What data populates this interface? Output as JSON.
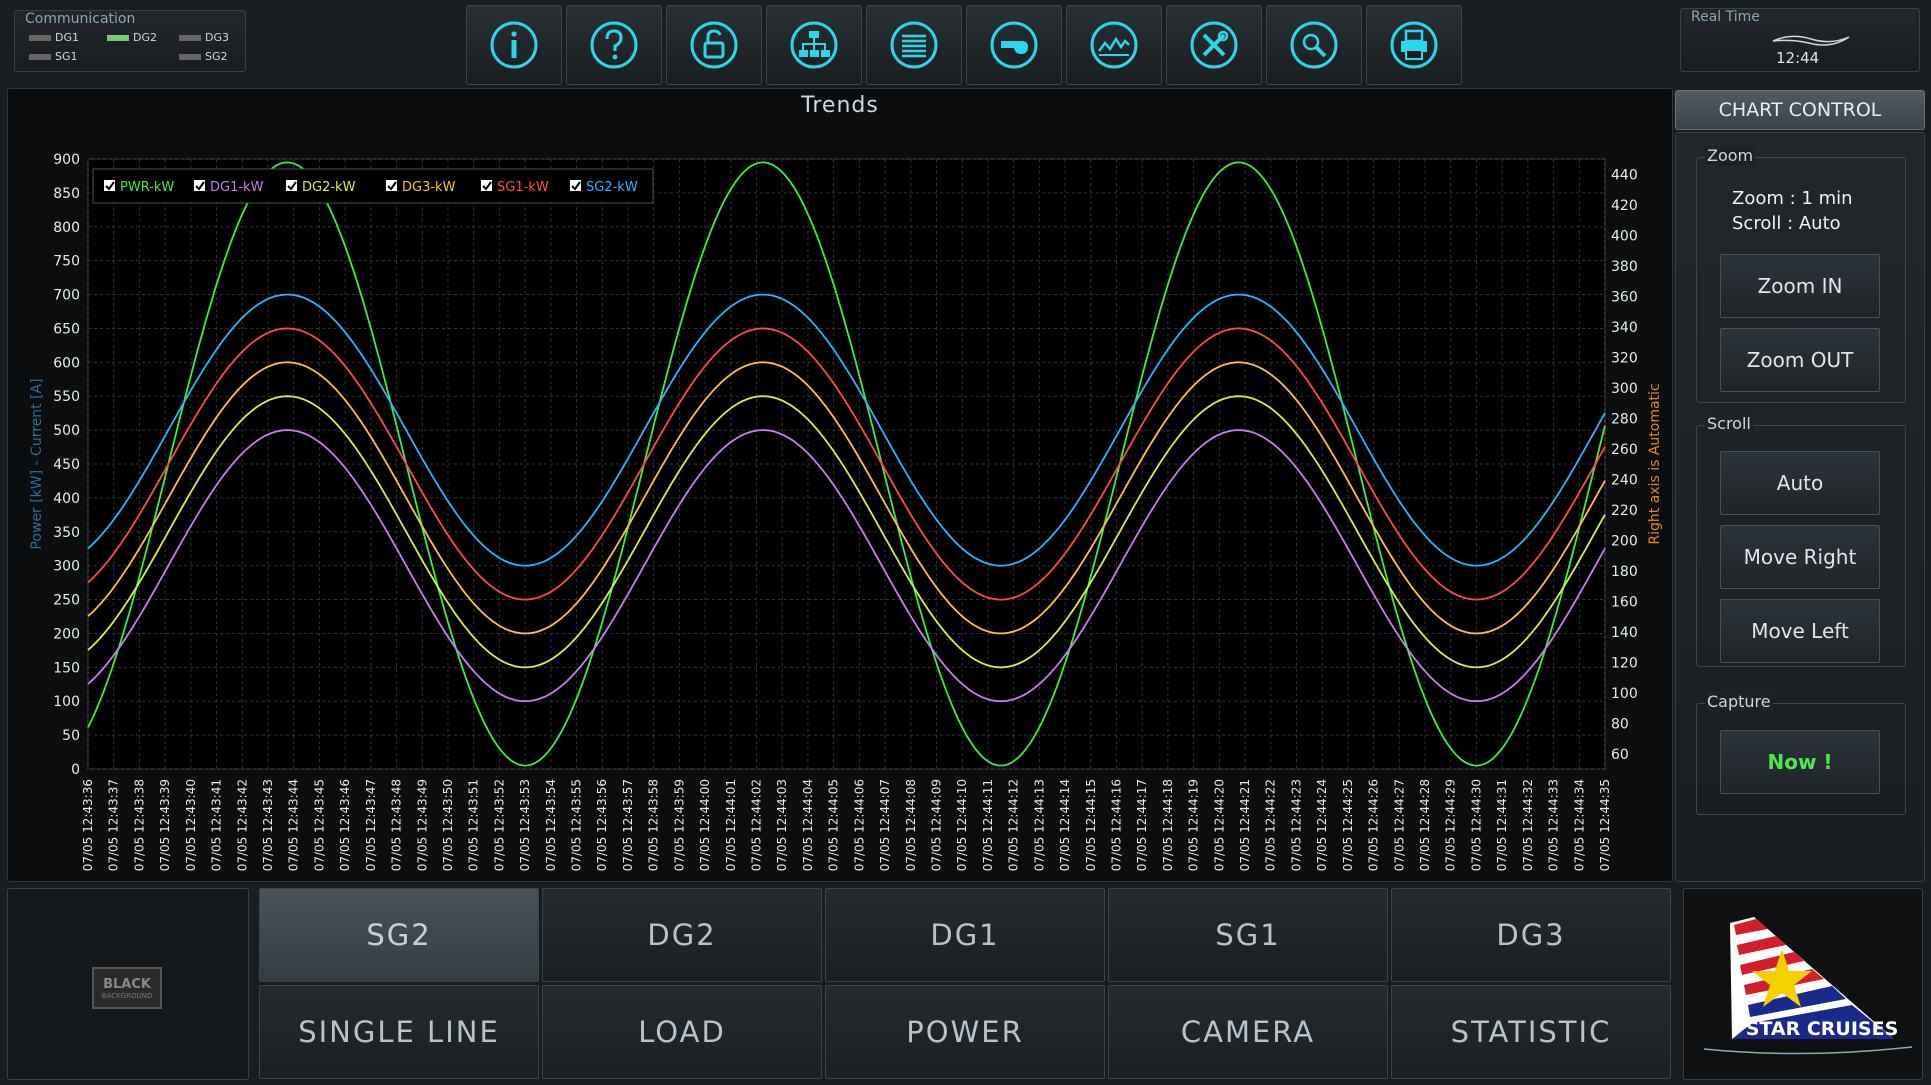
{
  "communication": {
    "title": "Communication",
    "items": [
      {
        "label": "DG1",
        "active": false
      },
      {
        "label": "DG2",
        "active": true
      },
      {
        "label": "DG3",
        "active": false
      },
      {
        "label": "SG1",
        "active": false
      },
      {
        "label": "SG2",
        "active": false
      }
    ]
  },
  "toolbar": {
    "icons": [
      "info-icon",
      "help-icon",
      "unlock-icon",
      "network-icon",
      "list-icon",
      "whistle-icon",
      "trend-icon",
      "tools-icon",
      "search-icon",
      "printer-icon"
    ]
  },
  "realtime": {
    "title": "Real Time",
    "time": "12:44"
  },
  "chart_area": {
    "title": "Trends"
  },
  "chart_data": {
    "type": "line",
    "title": "Trends",
    "ylabel": "Power [kW] - Current [A]",
    "y2label": "Right axis  is Automatic",
    "ylim": [
      0,
      900
    ],
    "y2lim": [
      50,
      450
    ],
    "yticks": [
      0,
      50,
      100,
      150,
      200,
      250,
      300,
      350,
      400,
      450,
      500,
      550,
      600,
      650,
      700,
      750,
      800,
      850,
      900
    ],
    "y2ticks": [
      60,
      80,
      100,
      120,
      140,
      160,
      180,
      200,
      220,
      240,
      260,
      280,
      300,
      320,
      340,
      360,
      380,
      400,
      420,
      440
    ],
    "x_start": "07/05 12:43:36",
    "x_end": "07/05 12:44:35",
    "x_step_seconds": 1,
    "grid": true,
    "legend_placement": "top-left",
    "series": [
      {
        "name": "PWR-kW",
        "color": "#3af03a",
        "center": 450,
        "amplitude": 445,
        "period_s": 18.5,
        "phase_s": 7.75
      },
      {
        "name": "DG1-kW",
        "color": "#c77dea",
        "center": 300,
        "amplitude": 200,
        "period_s": 18.5,
        "phase_s": 7.75
      },
      {
        "name": "DG2-kW",
        "color": "#d8f03a",
        "center": 350,
        "amplitude": 200,
        "period_s": 18.5,
        "phase_s": 7.75
      },
      {
        "name": "DG3-kW",
        "color": "#ffc13a",
        "center": 400,
        "amplitude": 200,
        "period_s": 18.5,
        "phase_s": 7.75
      },
      {
        "name": "SG1-kW",
        "color": "#ff4a4a",
        "center": 450,
        "amplitude": 200,
        "period_s": 18.5,
        "phase_s": 7.75
      },
      {
        "name": "SG2-kW",
        "color": "#2ab4ff",
        "center": 500,
        "amplitude": 200,
        "period_s": 18.5,
        "phase_s": 7.75
      }
    ]
  },
  "chart_control": {
    "title": "CHART CONTROL",
    "zoom_group": "Zoom",
    "zoom_status": "Zoom : 1 min",
    "scroll_status": "Scroll : Auto",
    "zoom_in": "Zoom IN",
    "zoom_out": "Zoom OUT",
    "scroll_group": "Scroll",
    "scroll_auto": "Auto",
    "move_right": "Move Right",
    "move_left": "Move Left",
    "capture_group": "Capture",
    "capture_now": "Now !"
  },
  "bottom": {
    "background_button": "BLACK",
    "background_sub": "BACKGROUND",
    "row1": [
      "SG2",
      "DG2",
      "DG1",
      "SG1",
      "DG3"
    ],
    "row2": [
      "SINGLE LINE",
      "LOAD",
      "POWER",
      "CAMERA",
      "STATISTIC"
    ],
    "active": "SG2"
  },
  "brand": {
    "name": "STAR CRUISES",
    "colors": {
      "red": "#d21f2b",
      "blue": "#1a2a8c",
      "star": "#f4d000"
    }
  },
  "accent_color": "#2ad7e8"
}
